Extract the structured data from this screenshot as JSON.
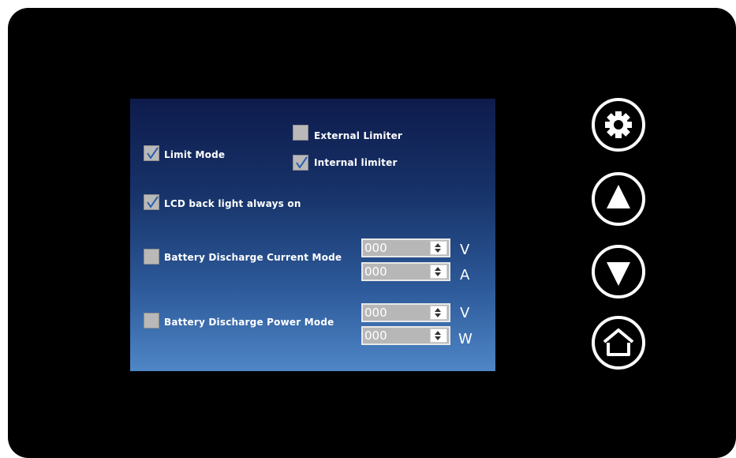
{
  "screen": {
    "limit_mode": {
      "label": "Limit Mode",
      "checked": true
    },
    "external_limiter": {
      "label": "External Limiter",
      "checked": false
    },
    "internal_limiter": {
      "label": "Internal limiter",
      "checked": true
    },
    "lcd_backlight": {
      "label": "LCD back light always on",
      "checked": true
    },
    "current_mode": {
      "label": "Battery  Discharge Current Mode",
      "checked": false,
      "voltage": {
        "value": "000",
        "unit": "V"
      },
      "current": {
        "value": "000",
        "unit": "A"
      }
    },
    "power_mode": {
      "label": "Battery  Discharge Power Mode",
      "checked": false,
      "voltage": {
        "value": "000",
        "unit": "V"
      },
      "power": {
        "value": "000",
        "unit": "W"
      }
    }
  },
  "buttons": [
    {
      "name": "settings",
      "icon": "gear-icon"
    },
    {
      "name": "up",
      "icon": "triangle-up-icon"
    },
    {
      "name": "down",
      "icon": "triangle-down-icon"
    },
    {
      "name": "home",
      "icon": "home-icon"
    }
  ],
  "colors": {
    "device": "#000000",
    "screen_top": "#0e1b4c",
    "screen_bottom": "#4f86c6",
    "checkbox": "#b9b9b9",
    "checkmark": "#2a5db0"
  }
}
